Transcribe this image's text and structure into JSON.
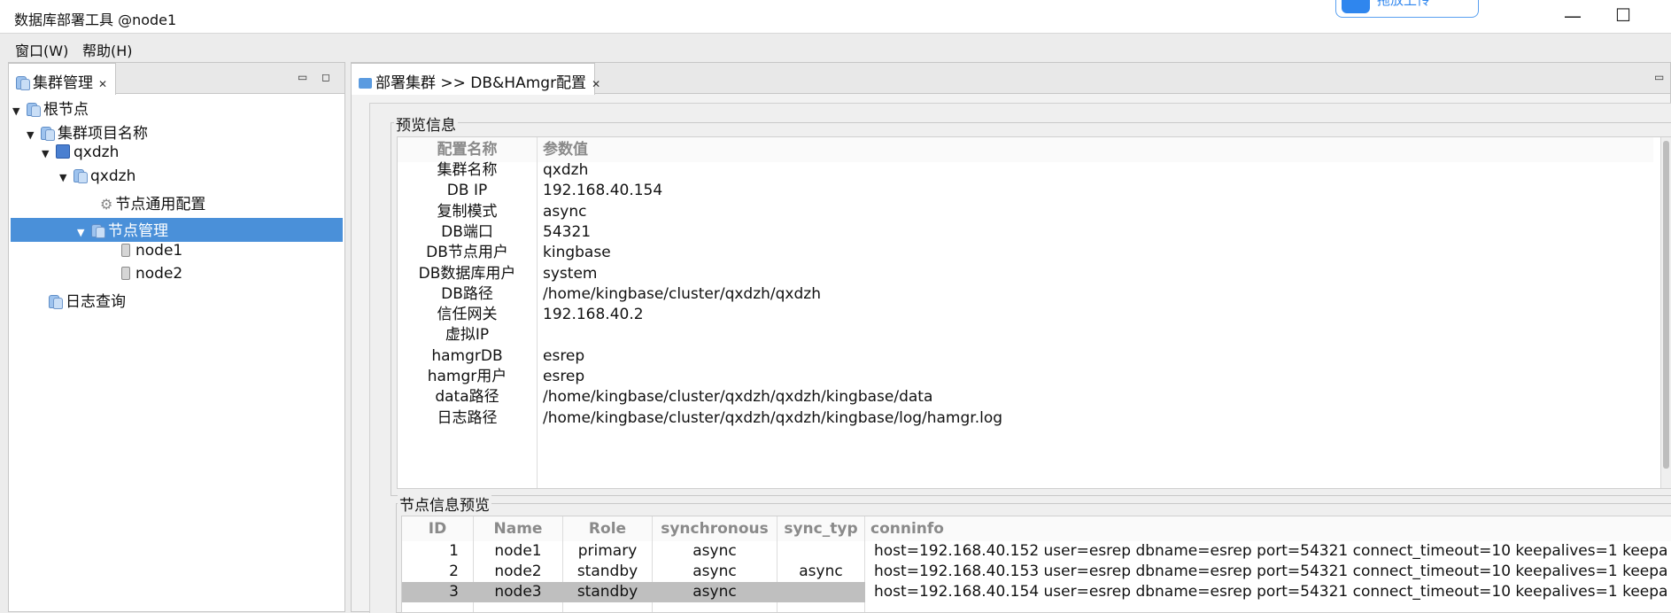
{
  "window": {
    "title": "数据库部署工具 @node1",
    "upload_badge": "拖放上传"
  },
  "menu": [
    {
      "label": "窗口(W)"
    },
    {
      "label": "帮助(H)"
    }
  ],
  "left_panel": {
    "tab_label": "集群管理",
    "tree": [
      {
        "label": "根节点"
      },
      {
        "label": "集群项目名称"
      },
      {
        "label": "qxdzh"
      },
      {
        "label": "qxdzh"
      },
      {
        "label": "节点通用配置"
      },
      {
        "label": "节点管理"
      },
      {
        "label": "node1"
      },
      {
        "label": "node2"
      },
      {
        "label": "日志查询"
      }
    ]
  },
  "right_panel": {
    "tab_label": "部署集群 >> DB&HAmgr配置",
    "preview": {
      "group_label": "预览信息",
      "headers": [
        "配置名称",
        "参数值"
      ],
      "rows": [
        [
          "集群名称",
          "qxdzh"
        ],
        [
          "DB IP",
          "192.168.40.154"
        ],
        [
          "复制模式",
          "async"
        ],
        [
          "DB端口",
          "54321"
        ],
        [
          "DB节点用户",
          "kingbase"
        ],
        [
          "DB数据库用户",
          "system"
        ],
        [
          "DB路径",
          "/home/kingbase/cluster/qxdzh/qxdzh"
        ],
        [
          "信任网关",
          "192.168.40.2"
        ],
        [
          "虚拟IP",
          ""
        ],
        [
          "hamgrDB",
          "esrep"
        ],
        [
          "hamgr用户",
          "esrep"
        ],
        [
          "data路径",
          "/home/kingbase/cluster/qxdzh/qxdzh/kingbase/data"
        ],
        [
          "日志路径",
          "/home/kingbase/cluster/qxdzh/qxdzh/kingbase/log/hamgr.log"
        ]
      ]
    },
    "nodes": {
      "group_label": "节点信息预览",
      "headers": [
        "ID",
        "Name",
        "Role",
        "synchronous",
        "sync_typ",
        "conninfo"
      ],
      "rows": [
        [
          "1",
          "node1",
          "primary",
          "async",
          "",
          "host=192.168.40.152 user=esrep dbname=esrep port=54321 connect_timeout=10 keepalives=1 keepa"
        ],
        [
          "2",
          "node2",
          "standby",
          "async",
          "async",
          "host=192.168.40.153 user=esrep dbname=esrep port=54321 connect_timeout=10 keepalives=1 keepa"
        ],
        [
          "3",
          "node3",
          "standby",
          "async",
          "",
          "host=192.168.40.154 user=esrep dbname=esrep port=54321 connect_timeout=10 keepalives=1 keepa"
        ]
      ]
    }
  }
}
